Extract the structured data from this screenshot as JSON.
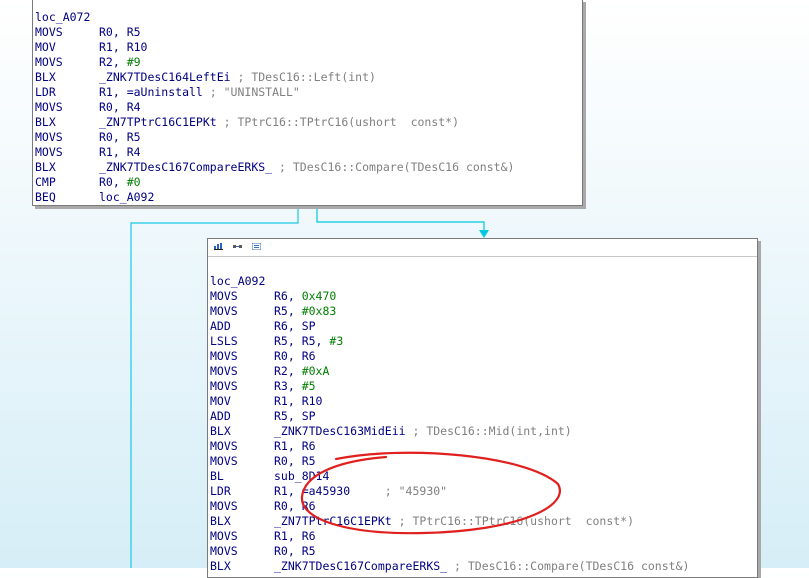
{
  "edge_colors": {
    "fallthrough": "#1ac8e8",
    "branch": "#00c8e0"
  },
  "annotation_color": "#e0201e",
  "header_icons": [
    "graph-view-icon",
    "proximity-icon",
    "text-view-icon"
  ],
  "block_a072": {
    "lines": [
      {
        "label": "loc_A072"
      },
      {
        "mn": "MOVS",
        "op": "R0, R5"
      },
      {
        "mn": "MOV",
        "op": "R1, R10"
      },
      {
        "mn": "MOVS",
        "op": "R2, ",
        "num": "#9"
      },
      {
        "mn": "BLX",
        "sym": "_ZNK7TDesC164LeftEi",
        "cmt": " ; TDesC16::Left(int)"
      },
      {
        "mn": "LDR",
        "op": "R1, =aUninstall",
        "cmt": " ; \"UNINSTALL\""
      },
      {
        "mn": "MOVS",
        "op": "R0, R4"
      },
      {
        "mn": "BLX",
        "sym": "_ZN7TPtrC16C1EPKt",
        "cmt": " ; TPtrC16::TPtrC16(ushort  const*)"
      },
      {
        "mn": "MOVS",
        "op": "R0, R5"
      },
      {
        "mn": "MOVS",
        "op": "R1, R4"
      },
      {
        "mn": "BLX",
        "sym": "_ZNK7TDesC167CompareERKS_",
        "cmt": " ; TDesC16::Compare(TDesC16 const&)"
      },
      {
        "mn": "CMP",
        "op": "R0, ",
        "num": "#0"
      },
      {
        "mn": "BEQ",
        "op": "loc_A092"
      }
    ]
  },
  "block_a092": {
    "lines": [
      {
        "label": "loc_A092"
      },
      {
        "mn": "MOVS",
        "op": "R6, ",
        "num": "0x470"
      },
      {
        "mn": "MOVS",
        "op": "R5, ",
        "num": "#0x83"
      },
      {
        "mn": "ADD",
        "op": "R6, SP"
      },
      {
        "mn": "LSLS",
        "op": "R5, R5, ",
        "num": "#3"
      },
      {
        "mn": "MOVS",
        "op": "R0, R6"
      },
      {
        "mn": "MOVS",
        "op": "R2, ",
        "num": "#0xA"
      },
      {
        "mn": "MOVS",
        "op": "R3, ",
        "num": "#5"
      },
      {
        "mn": "MOV",
        "op": "R1, R10"
      },
      {
        "mn": "ADD",
        "op": "R5, SP"
      },
      {
        "mn": "BLX",
        "sym": "_ZNK7TDesC163MidEii",
        "cmt": " ; TDesC16::Mid(int,int)"
      },
      {
        "mn": "MOVS",
        "op": "R1, R6"
      },
      {
        "mn": "MOVS",
        "op": "R0, R5"
      },
      {
        "mn": "BL",
        "sym": "sub_8D14"
      },
      {
        "mn": "LDR",
        "op": "R1, =a45930",
        "cmt": "     ; \"45930\""
      },
      {
        "mn": "MOVS",
        "op": "R0, R6"
      },
      {
        "mn": "BLX",
        "sym": "_ZN7TPtrC16C1EPKt",
        "cmt": " ; TPtrC16::TPtrC16(ushort  const*)"
      },
      {
        "mn": "MOVS",
        "op": "R1, R6"
      },
      {
        "mn": "MOVS",
        "op": "R0, R5"
      },
      {
        "mn": "BLX",
        "sym": "_ZNK7TDesC167CompareERKS_",
        "cmt": " ; TDesC16::Compare(TDesC16 const&)"
      }
    ]
  }
}
